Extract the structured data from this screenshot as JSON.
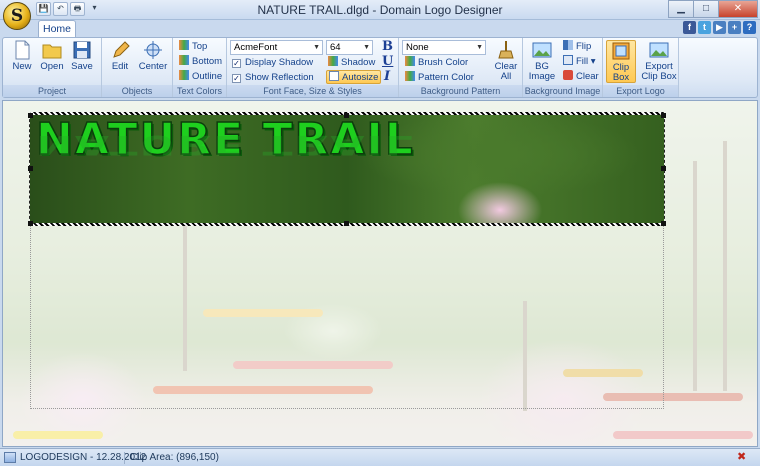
{
  "window": {
    "title": "NATURE TRAIL.dlgd - Domain Logo Designer",
    "app_icon_letter": "S",
    "controls": [
      "minimize",
      "maximize",
      "close"
    ]
  },
  "qat": [
    {
      "icon": "save-icon",
      "glyph": "💾"
    },
    {
      "icon": "undo-icon",
      "glyph": "↶"
    },
    {
      "icon": "print-icon",
      "glyph": "🖶"
    },
    {
      "icon": "qat-menu-icon",
      "glyph": "▾"
    }
  ],
  "tabs": [
    {
      "label": "Home"
    }
  ],
  "social": [
    {
      "icon": "facebook-icon",
      "glyph": "f",
      "color": "#3b5998"
    },
    {
      "icon": "twitter-icon",
      "glyph": "t",
      "color": "#4aa3df"
    },
    {
      "icon": "youtube-icon",
      "glyph": "▶",
      "color": "#4a7fc1"
    },
    {
      "icon": "share-icon",
      "glyph": "+",
      "color": "#4a7fc1"
    },
    {
      "icon": "help-icon",
      "glyph": "?",
      "color": "#2d6cc0"
    }
  ],
  "ribbon": {
    "project": {
      "label": "Project",
      "new": "New",
      "open": "Open",
      "save": "Save"
    },
    "objects": {
      "label": "Objects",
      "edit": "Edit",
      "center": "Center"
    },
    "text_colors": {
      "label": "Text Colors",
      "top": "Top",
      "bottom": "Bottom",
      "outline": "Outline"
    },
    "font": {
      "label": "Font Face, Size & Styles",
      "font_name": "AcmeFont",
      "font_size": "64",
      "display_shadow": "Display Shadow",
      "display_shadow_checked": true,
      "show_reflection": "Show Reflection",
      "show_reflection_checked": true,
      "shadow": "Shadow",
      "autosize": "Autosize",
      "bold": "B",
      "underline": "U",
      "italic": "I"
    },
    "background_pattern": {
      "label": "Background Pattern",
      "pattern": "None",
      "brush_color": "Brush Color",
      "pattern_color": "Pattern Color",
      "clear_all_line1": "Clear",
      "clear_all_line2": "All"
    },
    "background_image": {
      "label": "Background Image",
      "bg_image_line1": "BG",
      "bg_image_line2": "Image",
      "flip": "Flip",
      "fill": "Fill",
      "clear": "Clear"
    },
    "export_logo": {
      "label": "Export Logo",
      "clip_box_line1": "Clip",
      "clip_box_line2": "Box",
      "export_line1": "Export",
      "export_line2": "Clip Box"
    }
  },
  "canvas": {
    "logo_text": "NATURE TRAIL",
    "logo_color": "#1ecf1e"
  },
  "status": {
    "document": "LOGODESIGN - 12.28.2012",
    "clip_area": "Clip Area: (896,150)"
  }
}
